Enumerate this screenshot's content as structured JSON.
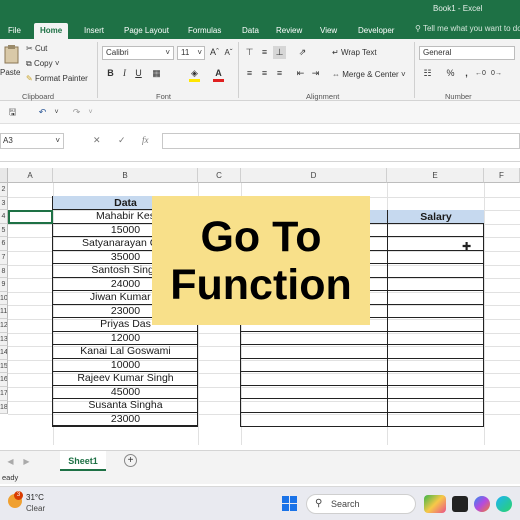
{
  "app": {
    "doc_title": "Book1 - Excel"
  },
  "tabs": [
    "File",
    "Home",
    "Insert",
    "Page Layout",
    "Formulas",
    "Data",
    "Review",
    "View",
    "Developer"
  ],
  "tell_me": "Tell me what you want to do",
  "ribbon": {
    "clipboard": {
      "paste": "Paste",
      "cut": "Cut",
      "copy": "Copy",
      "format_painter": "Format Painter",
      "label": "Clipboard"
    },
    "font": {
      "name": "Calibri",
      "size": "11",
      "label": "Font"
    },
    "alignment": {
      "wrap_text": "Wrap Text",
      "merge_center": "Merge & Center",
      "label": "Alignment"
    },
    "number": {
      "format": "General",
      "label": "Number"
    }
  },
  "formula_bar": {
    "name_box": "A3"
  },
  "columns": [
    "A",
    "B",
    "C",
    "D",
    "E",
    "F"
  ],
  "rows": [
    "2",
    "3",
    "4",
    "5",
    "6",
    "7",
    "8",
    "9",
    "10",
    "11",
    "12",
    "13",
    "14",
    "15",
    "16",
    "17",
    "18"
  ],
  "table1": {
    "header": "Data",
    "values": [
      "Mahabir Kes",
      "15000",
      "Satyanarayan Cha",
      "35000",
      "Santosh Singh",
      "24000",
      "Jiwan Kumar N",
      "23000",
      "Priyas Das",
      "12000",
      "Kanai Lal Goswami",
      "10000",
      "Rajeev Kumar Singh",
      "45000",
      "Susanta Singha",
      "23000"
    ]
  },
  "table2": {
    "header": "Salary"
  },
  "overlay": {
    "line1": "Go To",
    "line2": "Function"
  },
  "sheet_tab": "Sheet1",
  "status": "eady",
  "taskbar": {
    "temp": "31°C",
    "weather": "Clear",
    "search": "Search",
    "badge": "3"
  }
}
